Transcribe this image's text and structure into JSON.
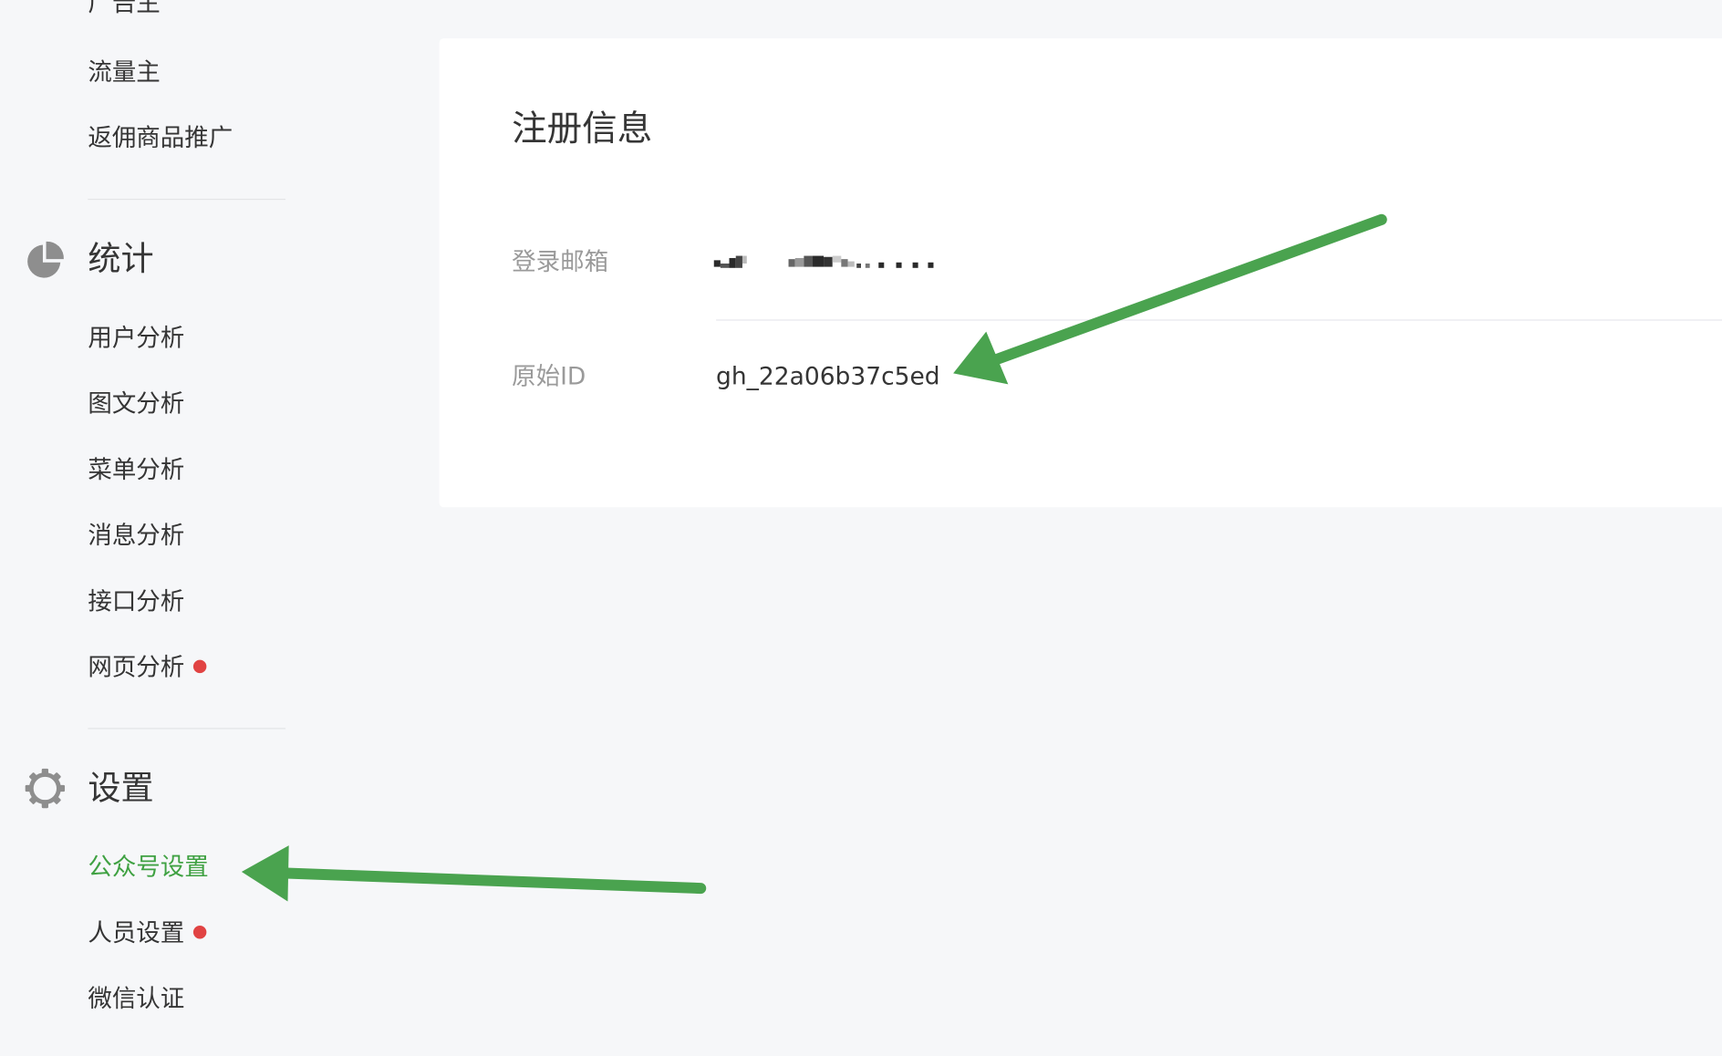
{
  "sidebar": {
    "top_partial_label": "广告主",
    "ad_items": [
      "流量主",
      "返佣商品推广"
    ],
    "stats": {
      "title": "统计",
      "icon": "pie-chart-icon",
      "items": [
        {
          "label": "用户分析",
          "dot": false
        },
        {
          "label": "图文分析",
          "dot": false
        },
        {
          "label": "菜单分析",
          "dot": false
        },
        {
          "label": "消息分析",
          "dot": false
        },
        {
          "label": "接口分析",
          "dot": false
        },
        {
          "label": "网页分析",
          "dot": true
        }
      ]
    },
    "settings": {
      "title": "设置",
      "icon": "gear-icon",
      "items": [
        {
          "label": "公众号设置",
          "active": true,
          "dot": false
        },
        {
          "label": "人员设置",
          "active": false,
          "dot": true
        },
        {
          "label": "微信认证",
          "active": false,
          "dot": false
        }
      ]
    }
  },
  "card": {
    "title": "注册信息",
    "fields": [
      {
        "label": "登录邮箱",
        "value": "",
        "redacted": true
      },
      {
        "label": "原始ID",
        "value": "gh_22a06b37c5ed"
      }
    ]
  },
  "colors": {
    "accent_green": "#3fa142",
    "arrow_green": "#4aa34f",
    "notice_red": "#e14343",
    "page_bg": "#f6f7f9"
  }
}
